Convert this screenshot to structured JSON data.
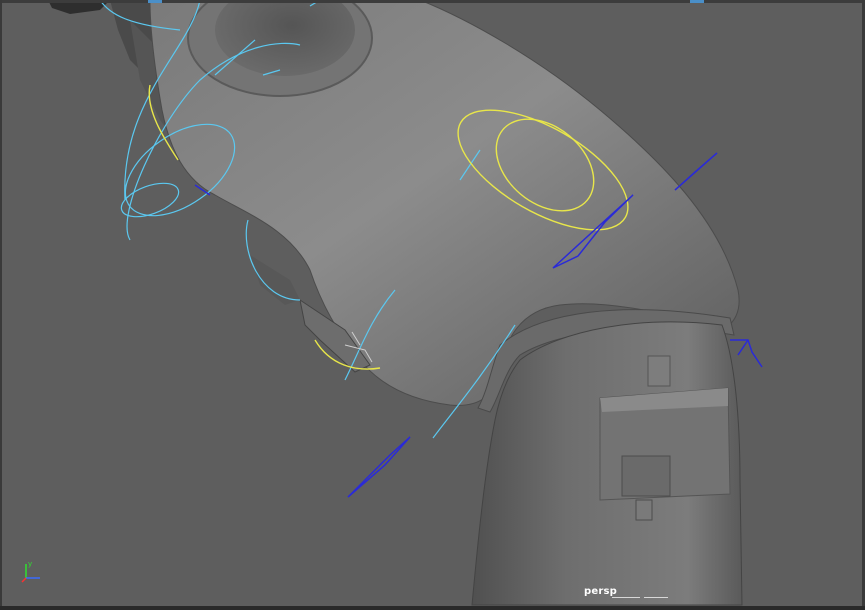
{
  "viewport": {
    "camera_name": "persp",
    "colors": {
      "background": "#5e5e5e",
      "mesh_light": "#8a8a8a",
      "mesh_mid": "#6f6f6f",
      "mesh_dark": "#454545",
      "control_cyan": "#5bc8f0",
      "control_yellow": "#e8e64a",
      "joint_blue": "#2a2ad8"
    }
  },
  "axis_gizmo": {
    "y_label": "y",
    "y_color": "#2ee02e",
    "z_color": "#3a6cff",
    "x_color": "#ff3030"
  }
}
